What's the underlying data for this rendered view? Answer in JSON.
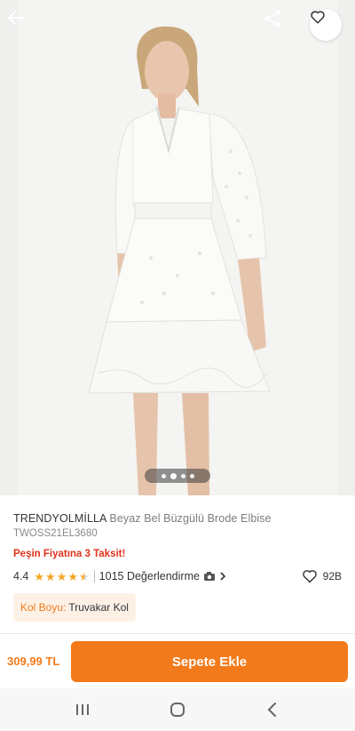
{
  "product": {
    "brand": "TRENDYOLMİLLA",
    "name": "Beyaz Bel Büzgülü Brode Elbise",
    "sku": "TWOSS21EL3680",
    "installment_text": "Peşin Fiyatına 3 Taksit!",
    "rating": "4.4",
    "rating_value": 4.4,
    "review_text": "1015 Değerlendirme",
    "favorite_count": "92B",
    "variant_label": "Kol Boyu:",
    "variant_value": "Truvakar Kol",
    "price": "309,99 TL",
    "add_to_cart": "Sepete Ekle"
  },
  "gallery": {
    "image_count": 4,
    "active_index": 1
  },
  "icons": {
    "back": "arrow-left-icon",
    "share": "share-icon",
    "favorite": "heart-icon",
    "camera": "camera-icon",
    "chevron": "chevron-right-icon",
    "nav_recent": "recent-apps-icon",
    "nav_home": "home-icon",
    "nav_back": "back-icon"
  },
  "colors": {
    "accent": "#f27a1a",
    "installment": "#e0321b",
    "star": "#f5a623",
    "chip_bg": "#fdf1e6"
  }
}
